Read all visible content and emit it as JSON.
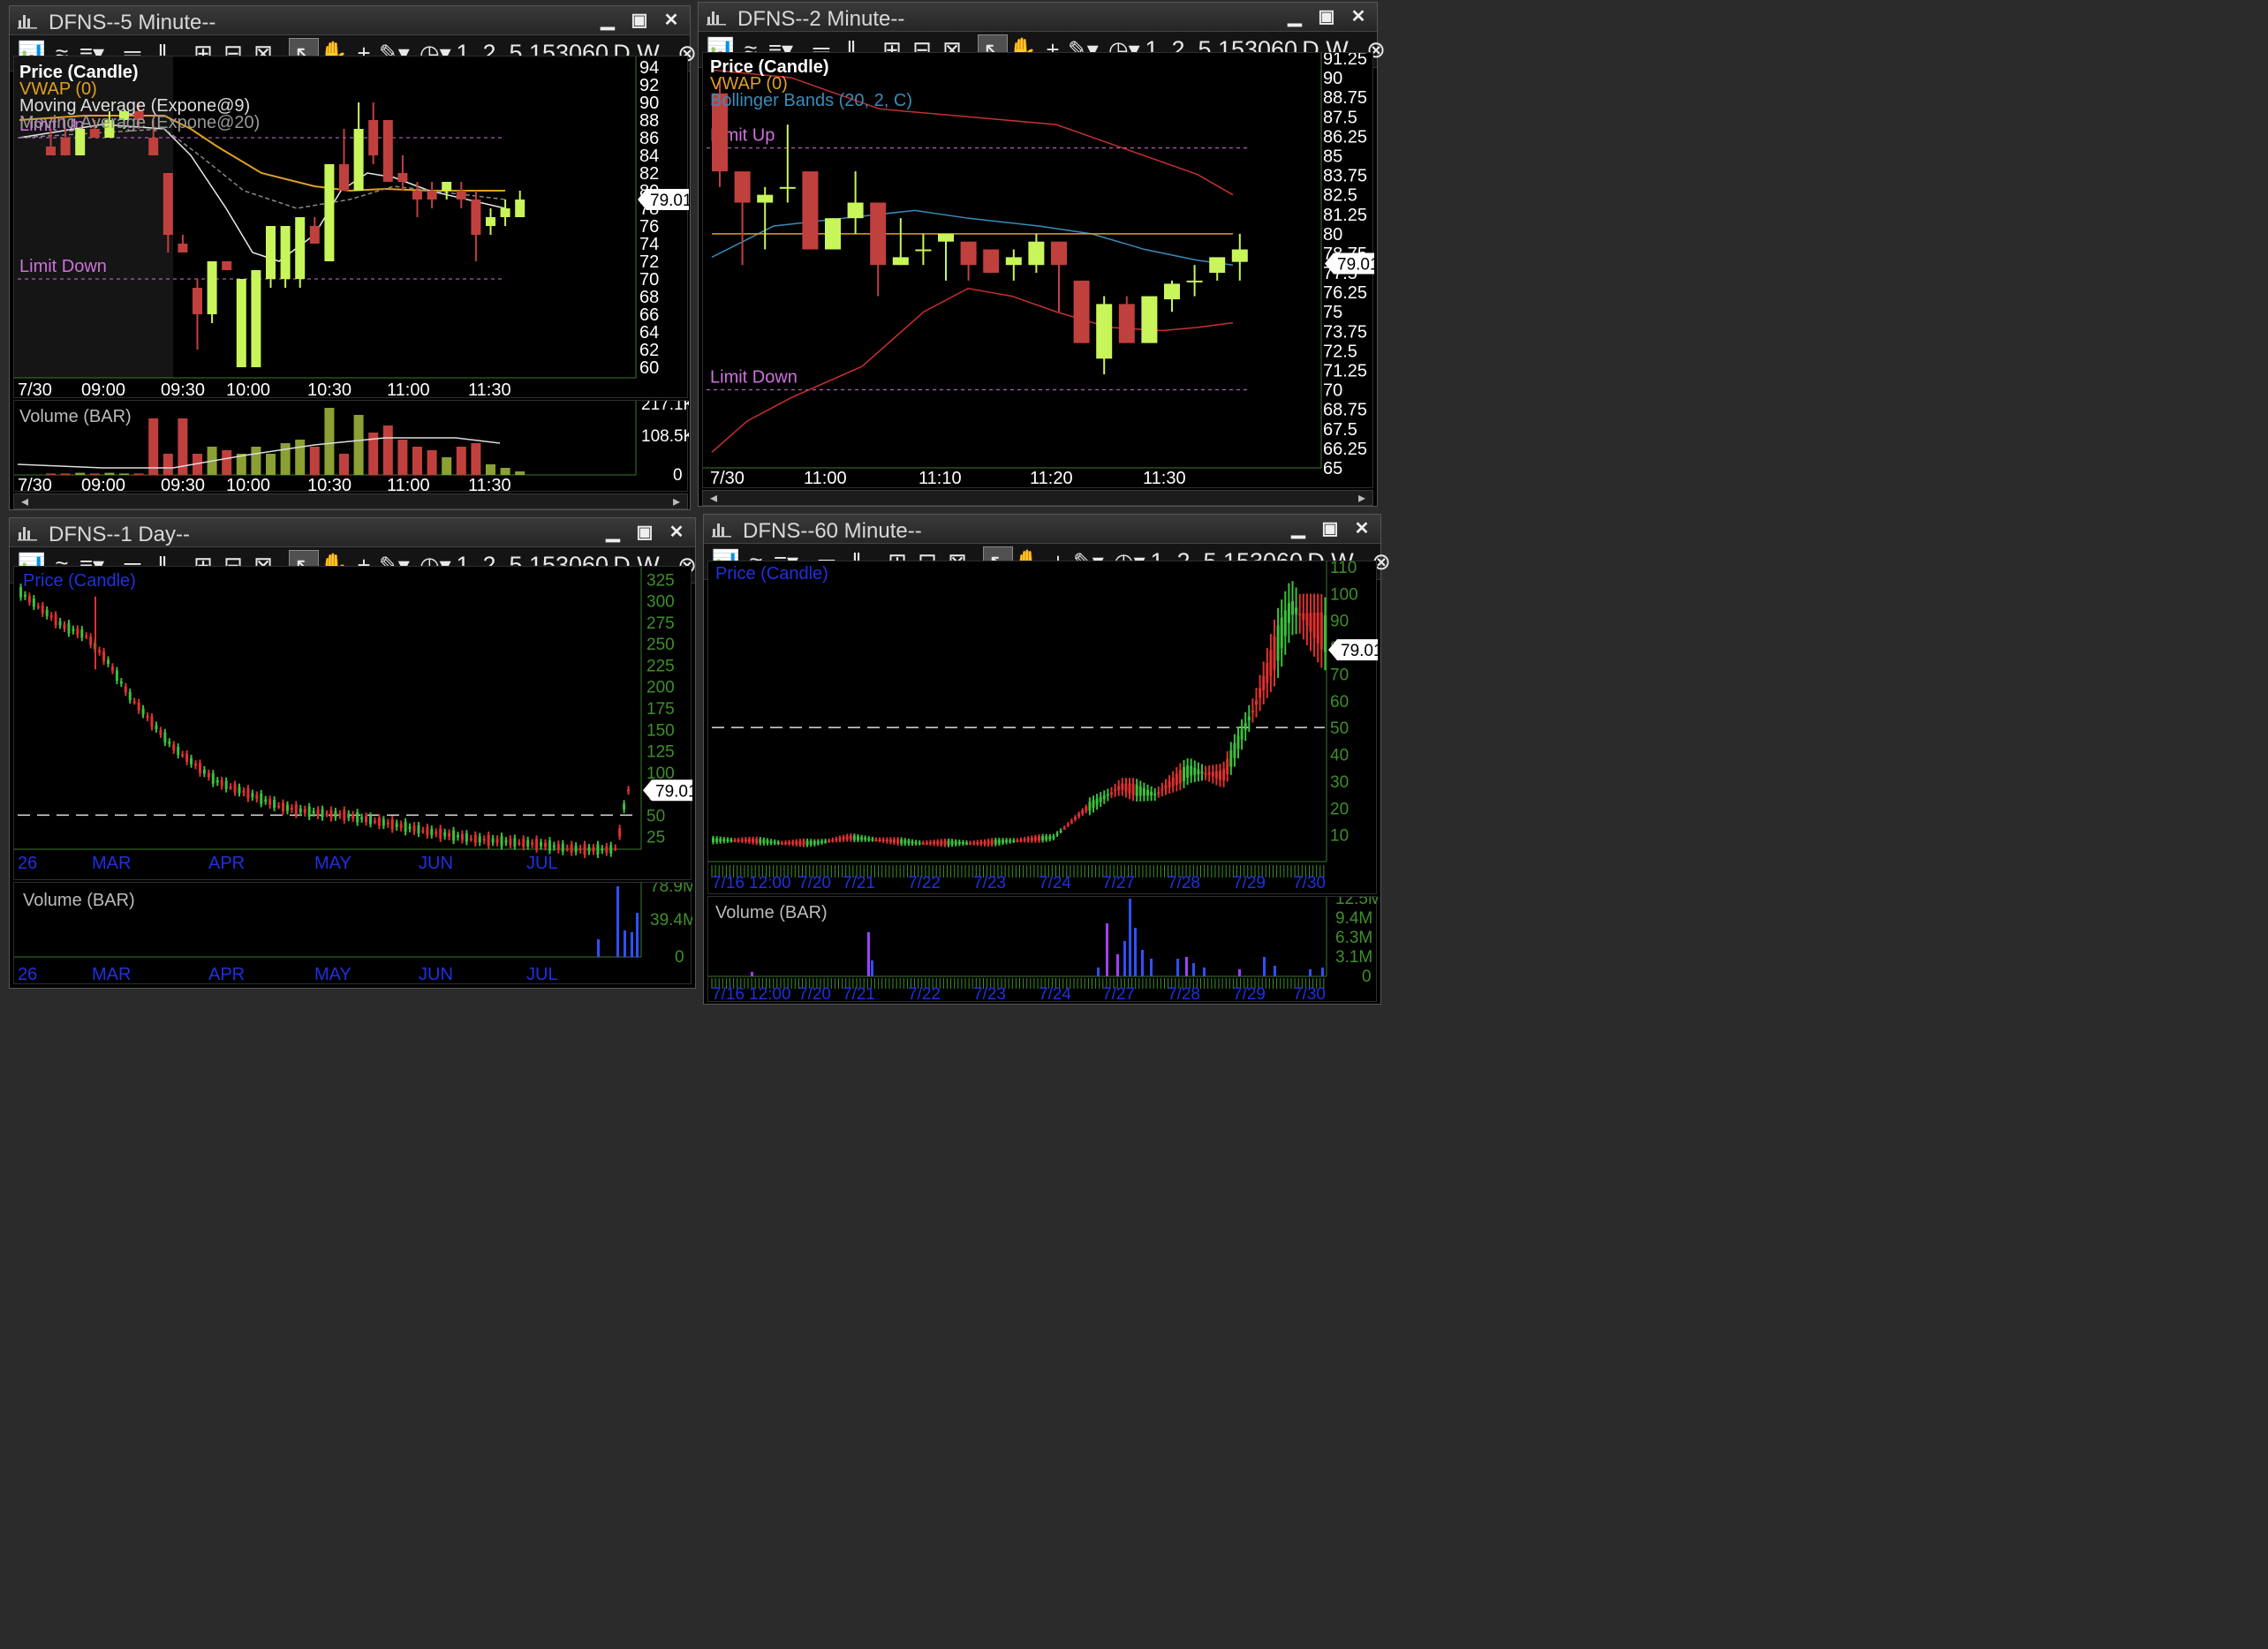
{
  "windows": {
    "w5": {
      "title": "DFNS--5 Minute--",
      "legend": [
        "Price (Candle)",
        "VWAP (0)",
        "Moving Average (Expone@9)",
        "Moving Average (Expone@20)"
      ],
      "limit_up": "Limit Up",
      "limit_down": "Limit Down",
      "price_tag": "79.01",
      "y_ticks": [
        "94",
        "92",
        "90",
        "88",
        "86",
        "84",
        "82",
        "80",
        "78",
        "76",
        "74",
        "72",
        "70",
        "68",
        "66",
        "64",
        "62",
        "60"
      ],
      "x_labels": [
        "7/30",
        "09:00",
        "09:30",
        "10:00",
        "10:30",
        "11:00",
        "11:30"
      ],
      "volume_title": "Volume (BAR)",
      "volume_ticks": [
        "217.1K",
        "108.5K",
        "0"
      ]
    },
    "w2": {
      "title": "DFNS--2 Minute--",
      "legend": [
        "Price (Candle)",
        "VWAP (0)",
        "Bollinger Bands (20, 2, C)"
      ],
      "limit_up": "Limit Up",
      "limit_down": "Limit Down",
      "price_tag": "79.01",
      "y_ticks": [
        "91.25",
        "90",
        "88.75",
        "87.5",
        "86.25",
        "85",
        "83.75",
        "82.5",
        "81.25",
        "80",
        "78.75",
        "77.5",
        "76.25",
        "75",
        "73.75",
        "72.5",
        "71.25",
        "70",
        "68.75",
        "67.5",
        "66.25",
        "65"
      ],
      "x_labels": [
        "7/30",
        "11:00",
        "11:10",
        "11:20",
        "11:30"
      ]
    },
    "w1d": {
      "title": "DFNS--1 Day--",
      "legend": [
        "Price (Candle)"
      ],
      "price_tag": "79.01",
      "y_ticks": [
        "325",
        "300",
        "275",
        "250",
        "225",
        "200",
        "175",
        "150",
        "125",
        "100",
        "75",
        "50",
        "25"
      ],
      "x_labels": [
        "26",
        "MAR",
        "APR",
        "MAY",
        "JUN",
        "JUL"
      ],
      "volume_title": "Volume (BAR)",
      "volume_ticks": [
        "78.9M",
        "39.4M",
        "0"
      ]
    },
    "w60": {
      "title": "DFNS--60 Minute--",
      "legend": [
        "Price (Candle)"
      ],
      "price_tag": "79.01",
      "y_ticks": [
        "110",
        "100",
        "90",
        "80",
        "70",
        "60",
        "50",
        "40",
        "30",
        "20",
        "10"
      ],
      "x_labels": [
        "7/16",
        "12:00",
        "7/20",
        "7/21",
        "7/22",
        "7/23",
        "7/24",
        "7/27",
        "7/28",
        "7/29",
        "7/30"
      ],
      "volume_title": "Volume (BAR)",
      "volume_ticks": [
        "12.5M",
        "9.4M",
        "6.3M",
        "3.1M",
        "0"
      ]
    }
  },
  "toolbar": {
    "periods": [
      "1",
      "2",
      "5",
      "15",
      "30",
      "60",
      "D",
      "W"
    ]
  },
  "colors": {
    "up": "#c8f55a",
    "down": "#c0403e",
    "vwap": "#e0a020",
    "ema9": "#e8e8e8",
    "limit": "#d070e0",
    "axis_green": "#3f8f2a",
    "bb": "#c83030",
    "bbmid": "#3a8cb8",
    "legend_blue": "#2030e0"
  },
  "chart_data": [
    {
      "type": "candlestick",
      "title": "DFNS--5 Minute--",
      "x_range": [
        "09:00",
        "11:35"
      ],
      "ylim": [
        60,
        94
      ],
      "candles": [
        {
          "o": 84,
          "h": 87,
          "l": 84,
          "c": 85,
          "d": "down"
        },
        {
          "o": 86,
          "h": 87,
          "l": 84,
          "c": 84,
          "d": "down"
        },
        {
          "o": 84,
          "h": 87,
          "l": 84,
          "c": 87,
          "d": "up"
        },
        {
          "o": 87,
          "h": 88,
          "l": 86,
          "c": 86,
          "d": "down"
        },
        {
          "o": 86,
          "h": 89,
          "l": 86,
          "c": 88,
          "d": "up"
        },
        {
          "o": 88,
          "h": 89,
          "l": 87,
          "c": 89,
          "d": "up"
        },
        {
          "o": 89,
          "h": 90,
          "l": 87,
          "c": 88,
          "d": "down"
        },
        {
          "o": 86,
          "h": 88,
          "l": 84,
          "c": 84,
          "d": "down"
        },
        {
          "o": 82,
          "h": 82,
          "l": 73,
          "c": 75,
          "d": "down"
        },
        {
          "o": 74,
          "h": 75,
          "l": 73,
          "c": 73,
          "d": "down"
        },
        {
          "o": 69,
          "h": 70,
          "l": 62,
          "c": 66,
          "d": "down"
        },
        {
          "o": 66,
          "h": 72,
          "l": 65,
          "c": 72,
          "d": "up"
        },
        {
          "o": 72,
          "h": 72,
          "l": 71,
          "c": 71,
          "d": "down"
        },
        {
          "o": 60,
          "h": 70,
          "l": 60,
          "c": 70,
          "d": "up"
        },
        {
          "o": 60,
          "h": 71,
          "l": 60,
          "c": 71,
          "d": "up"
        },
        {
          "o": 70,
          "h": 76,
          "l": 69,
          "c": 76,
          "d": "up"
        },
        {
          "o": 70,
          "h": 76,
          "l": 69,
          "c": 76,
          "d": "up"
        },
        {
          "o": 70,
          "h": 77,
          "l": 69,
          "c": 77,
          "d": "up"
        },
        {
          "o": 76,
          "h": 77,
          "l": 74,
          "c": 74,
          "d": "down"
        },
        {
          "o": 72,
          "h": 83,
          "l": 72,
          "c": 83,
          "d": "up"
        },
        {
          "o": 83,
          "h": 87,
          "l": 80,
          "c": 80,
          "d": "down"
        },
        {
          "o": 80,
          "h": 90,
          "l": 80,
          "c": 87,
          "d": "up"
        },
        {
          "o": 88,
          "h": 90,
          "l": 83,
          "c": 84,
          "d": "down"
        },
        {
          "o": 88,
          "h": 88,
          "l": 81,
          "c": 81,
          "d": "down"
        },
        {
          "o": 82,
          "h": 84,
          "l": 80,
          "c": 81,
          "d": "down"
        },
        {
          "o": 80,
          "h": 81,
          "l": 77,
          "c": 79,
          "d": "down"
        },
        {
          "o": 80,
          "h": 81,
          "l": 78,
          "c": 79,
          "d": "down"
        },
        {
          "o": 80,
          "h": 81,
          "l": 79,
          "c": 81,
          "d": "up"
        },
        {
          "o": 80,
          "h": 81,
          "l": 78,
          "c": 79,
          "d": "down"
        },
        {
          "o": 79,
          "h": 80,
          "l": 72,
          "c": 75,
          "d": "down"
        },
        {
          "o": 76,
          "h": 78,
          "l": 75,
          "c": 77,
          "d": "up"
        },
        {
          "o": 77,
          "h": 79,
          "l": 76,
          "c": 78,
          "d": "up"
        },
        {
          "o": 77,
          "h": 80,
          "l": 77,
          "c": 79,
          "d": "up"
        }
      ],
      "volume_ylim": [
        0,
        217100
      ]
    },
    {
      "type": "candlestick",
      "title": "DFNS--2 Minute--",
      "ylim": [
        65,
        91.25
      ],
      "candles_count": 24,
      "last": 79.01
    },
    {
      "type": "candlestick",
      "title": "DFNS--1 Day--",
      "ylim": [
        0,
        325
      ],
      "x_categories": [
        "26",
        "MAR",
        "APR",
        "MAY",
        "JUN",
        "JUL"
      ],
      "close_approx": [
        310,
        290,
        270,
        260,
        230,
        190,
        160,
        130,
        110,
        90,
        80,
        70,
        60,
        55,
        52,
        50,
        45,
        40,
        35,
        30,
        26,
        22,
        20,
        18,
        16,
        12,
        10,
        10,
        11,
        79.01
      ],
      "volume_ylim": [
        0,
        78900000
      ]
    },
    {
      "type": "candlestick",
      "title": "DFNS--60 Minute--",
      "ylim": [
        0,
        110
      ],
      "x_categories": [
        "7/16",
        "12:00",
        "7/20",
        "7/21",
        "7/22",
        "7/23",
        "7/24",
        "7/27",
        "7/28",
        "7/29",
        "7/30"
      ],
      "close_approx": [
        8,
        8,
        7,
        7,
        9,
        8,
        7,
        7,
        7,
        8,
        9,
        20,
        28,
        25,
        34,
        32,
        60,
        95,
        85,
        79.01
      ],
      "volume_ylim": [
        0,
        12500000
      ]
    }
  ]
}
